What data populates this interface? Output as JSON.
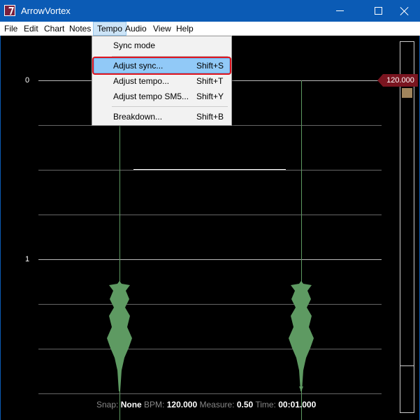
{
  "window": {
    "title": "ArrowVortex"
  },
  "menubar": {
    "items": [
      {
        "label": "File"
      },
      {
        "label": "Edit"
      },
      {
        "label": "Chart"
      },
      {
        "label": "Notes"
      },
      {
        "label": "Tempo"
      },
      {
        "label": "Audio"
      },
      {
        "label": "View"
      },
      {
        "label": "Help"
      }
    ]
  },
  "tempo_menu": {
    "items": [
      {
        "label": "Sync mode",
        "shortcut": ""
      },
      {
        "label": "Adjust sync...",
        "shortcut": "Shift+S"
      },
      {
        "label": "Adjust tempo...",
        "shortcut": "Shift+T"
      },
      {
        "label": "Adjust tempo SM5...",
        "shortcut": "Shift+Y"
      },
      {
        "label": "Breakdown...",
        "shortcut": "Shift+B"
      }
    ]
  },
  "editor": {
    "measures": [
      "0",
      "1"
    ],
    "bpm_marker": "120.000"
  },
  "status": {
    "snap_label": "Snap:",
    "snap_value": "None",
    "bpm_label": "BPM:",
    "bpm_value": "120.000",
    "measure_label": "Measure:",
    "measure_value": "0.50",
    "time_label": "Time:",
    "time_value": "00:01.000"
  },
  "colors": {
    "titlebar": "#0b5bb5",
    "waveform": "#5e9a62",
    "highlight": "#e0141e",
    "bpm_marker": "#7a1520"
  }
}
